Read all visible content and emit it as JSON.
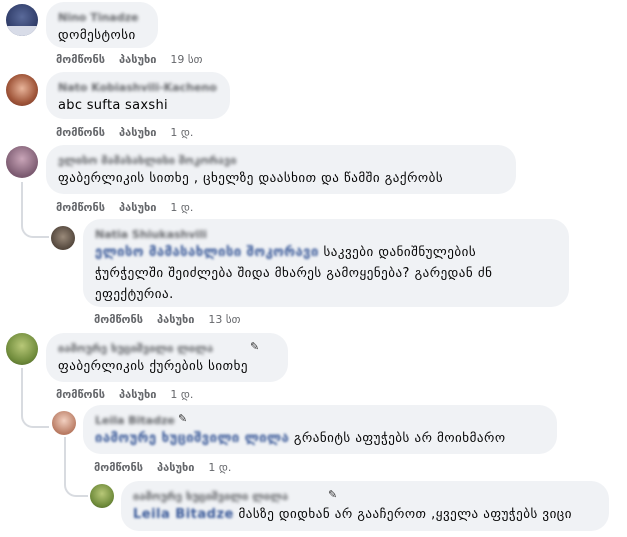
{
  "comments": [
    {
      "author": "Nino Tinadze",
      "text": "დომესტოსი",
      "actions": {
        "like": "მომწონს",
        "reply": "პასუხი",
        "time": "19 სთ"
      }
    },
    {
      "author": "Nato Kobiashvili-Kacheno",
      "text": "abc sufta saxshi",
      "actions": {
        "like": "მომწონს",
        "reply": "პასუხი",
        "time": "1 დ."
      }
    },
    {
      "author": "ელისო მამასახლისი შოკორავი",
      "text": "ფაბერლიკის სითხე , ცხელზე დაასხით და წამში გაქრობს",
      "actions": {
        "like": "მომწონს",
        "reply": "პასუხი",
        "time": "1 დ."
      }
    },
    {
      "author": "Natia Shiukashvili",
      "mention": "ელისო მამასახლისი შოკორავი",
      "text_line1": "საკვები დანიშნულების",
      "text_line2": "ჭურჭელში შეიძლება შიდა მხარეს გამოყენება? გარედან ძნ",
      "text_line3": "ეფექტურია.",
      "actions": {
        "like": "მომწონს",
        "reply": "პასუხი",
        "time": "13 სთ"
      }
    },
    {
      "author": "იამოურე ხუციშვილი ლილა",
      "badge": "✎",
      "text": "ფაბერლიკის ქურების სითხე",
      "actions": {
        "like": "მომწონს",
        "reply": "პასუხი",
        "time": "1 დ."
      }
    },
    {
      "author": "Leila Bitadze",
      "badge": "✎",
      "mention": "იამოურე ხუციშვილი ლილა",
      "text": "გრანიტს აფუჭებს არ მოიხმარო",
      "actions": {
        "like": "მომწონს",
        "reply": "პასუხი",
        "time": "1 დ."
      }
    },
    {
      "author": "იამოურე ხუციშვილი ლილა",
      "badge": "✎",
      "mention": "Leila Bitadze",
      "text": "მასზე დიდხან არ გააჩეროთ ,ყველა აფუჭებს ვიცი"
    }
  ],
  "colors": {
    "bubble": "#f0f2f5",
    "meta": "#65676b",
    "thread": "#d8dbe0"
  }
}
